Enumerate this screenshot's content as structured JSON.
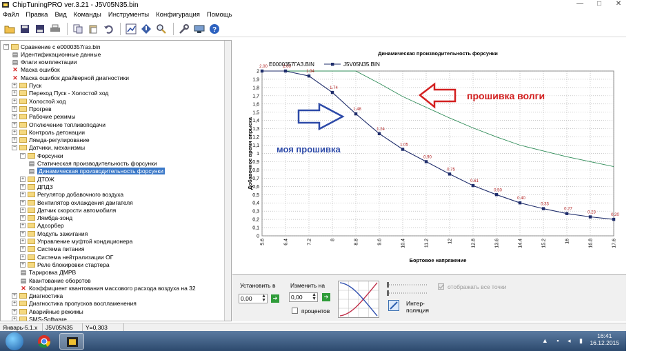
{
  "window": {
    "title": "ChipTuningPRO ver.3.21 - J5V05N35.bin",
    "controls": [
      "—",
      "□",
      "✕"
    ]
  },
  "menu": [
    "Файл",
    "Правка",
    "Вид",
    "Команды",
    "Инструменты",
    "Конфигурация",
    "Помощь"
  ],
  "toolbar_icons": [
    "open-icon",
    "save-icon",
    "save-as-icon",
    "print-icon",
    "copy-icon",
    "paste-icon",
    "undo-icon",
    "chart-icon",
    "diamond-icon",
    "search-icon",
    "tools-icon",
    "device-icon",
    "help-icon"
  ],
  "tree": [
    {
      "level": 0,
      "kind": "folder",
      "exp": "−",
      "label": "Сравнение с e0000357газ.bin"
    },
    {
      "level": 1,
      "kind": "doc",
      "label": "Идентификационные данные"
    },
    {
      "level": 1,
      "kind": "doc",
      "label": "Флаги комплектации"
    },
    {
      "level": 1,
      "kind": "x",
      "label": "Маска ошибок"
    },
    {
      "level": 1,
      "kind": "x",
      "label": "Маска ошибок драйверной диагностики"
    },
    {
      "level": 1,
      "kind": "folder",
      "exp": "+",
      "label": "Пуск"
    },
    {
      "level": 1,
      "kind": "folder",
      "exp": "+",
      "label": "Переход Пуск - Холостой ход"
    },
    {
      "level": 1,
      "kind": "folder",
      "exp": "+",
      "label": "Холостой ход"
    },
    {
      "level": 1,
      "kind": "folder",
      "exp": "+",
      "label": "Прогрев"
    },
    {
      "level": 1,
      "kind": "folder",
      "exp": "+",
      "label": "Рабочие режимы"
    },
    {
      "level": 1,
      "kind": "folder",
      "exp": "+",
      "label": "Отключение топливоподачи"
    },
    {
      "level": 1,
      "kind": "folder",
      "exp": "+",
      "label": "Контроль детонации"
    },
    {
      "level": 1,
      "kind": "folder",
      "exp": "+",
      "label": "Лямда-регулирование"
    },
    {
      "level": 1,
      "kind": "folder",
      "exp": "−",
      "label": "Датчики, механизмы"
    },
    {
      "level": 2,
      "kind": "folder",
      "exp": "−",
      "label": "Форсунки"
    },
    {
      "level": 3,
      "kind": "doc",
      "label": "Статическая производительность форсунки"
    },
    {
      "level": 3,
      "kind": "doc",
      "label": "Динамическая производительность форсунки",
      "selected": true
    },
    {
      "level": 2,
      "kind": "folder",
      "exp": "+",
      "label": "ДТОЖ"
    },
    {
      "level": 2,
      "kind": "folder",
      "exp": "+",
      "label": "ДПДЗ"
    },
    {
      "level": 2,
      "kind": "folder",
      "exp": "+",
      "label": "Регулятор добавочного воздуха"
    },
    {
      "level": 2,
      "kind": "folder",
      "exp": "+",
      "label": "Вентилятор охлаждения двигателя"
    },
    {
      "level": 2,
      "kind": "folder",
      "exp": "+",
      "label": "Датчик скорости автомобиля"
    },
    {
      "level": 2,
      "kind": "folder",
      "exp": "+",
      "label": "Лямбда-зонд"
    },
    {
      "level": 2,
      "kind": "folder",
      "exp": "+",
      "label": "Адсорбер"
    },
    {
      "level": 2,
      "kind": "folder",
      "exp": "+",
      "label": "Модуль зажигания"
    },
    {
      "level": 2,
      "kind": "folder",
      "exp": "+",
      "label": "Управление муфтой кондиционера"
    },
    {
      "level": 2,
      "kind": "folder",
      "exp": "+",
      "label": "Система питания"
    },
    {
      "level": 2,
      "kind": "folder",
      "exp": "+",
      "label": "Система нейтрализации ОГ"
    },
    {
      "level": 2,
      "kind": "folder",
      "exp": "+",
      "label": "Реле блокировки стартера"
    },
    {
      "level": 2,
      "kind": "doc",
      "label": "Тарировка ДМРВ"
    },
    {
      "level": 2,
      "kind": "doc",
      "label": "Квантование оборотов"
    },
    {
      "level": 2,
      "kind": "x",
      "label": "Коэффициент квантования массового расхода воздуха на 32"
    },
    {
      "level": 1,
      "kind": "folder",
      "exp": "+",
      "label": "Диагностика"
    },
    {
      "level": 1,
      "kind": "folder",
      "exp": "+",
      "label": "Диагностика пропусков воспламенения"
    },
    {
      "level": 1,
      "kind": "folder",
      "exp": "+",
      "label": "Аварийные режимы"
    },
    {
      "level": 1,
      "kind": "folder",
      "exp": "+",
      "label": "SMS-Software"
    }
  ],
  "chart_data": {
    "type": "line",
    "title": "Динамическая производительность форсунки",
    "xlabel": "Бортовое напряжение",
    "ylabel": "Добавочное время впрыска",
    "x": [
      5.6,
      6.4,
      7.2,
      8,
      8.8,
      9.6,
      10.4,
      11.2,
      12,
      12.8,
      13.6,
      14.4,
      15.2,
      16,
      16.8,
      17.6
    ],
    "xticks": [
      "5.6",
      "6.4",
      "7.2",
      "8",
      "8.8",
      "9.6",
      "10.4",
      "11.2",
      "12",
      "12.8",
      "13.6",
      "14.4",
      "15.2",
      "16",
      "16.8",
      "17.6"
    ],
    "xlim": [
      5.6,
      17.6
    ],
    "ylim": [
      0,
      2
    ],
    "yticks": [
      "0",
      "0,1",
      "0,2",
      "0,3",
      "0,4",
      "0,5",
      "0,6",
      "0,7",
      "0,8",
      "0,9",
      "1",
      "1,1",
      "1,2",
      "1,3",
      "1,4",
      "1,5",
      "1,6",
      "1,7",
      "1,8",
      "1,9",
      "2"
    ],
    "grid": true,
    "series": [
      {
        "name": "E0000357ГАЗ.BIN",
        "color": "#2e8b57",
        "markers": false,
        "values": [
          2.0,
          2.0,
          2.0,
          2.0,
          2.0,
          1.85,
          1.69,
          1.56,
          1.43,
          1.31,
          1.2,
          1.1,
          1.03,
          0.96,
          0.9,
          0.84
        ]
      },
      {
        "name": "J5V05N35.BIN",
        "color": "#1f2d6b",
        "markers": true,
        "values": [
          2.0,
          2.0,
          1.94,
          1.74,
          1.48,
          1.24,
          1.05,
          0.9,
          0.75,
          0.61,
          0.5,
          0.4,
          0.33,
          0.27,
          0.23,
          0.2
        ],
        "labels": [
          "2.00",
          "2.00",
          "1.94",
          "1.74",
          "1.48",
          "1.24",
          "1.05",
          "0.90",
          "0.75",
          "0.61",
          "0.50",
          "0.40",
          "0.33",
          "0.27",
          "0.23",
          "0.20"
        ]
      }
    ],
    "legend_placement": "top-left",
    "annotations": [
      {
        "text": "прошивка волги",
        "color": "#d32020"
      },
      {
        "text": "моя прошивка",
        "color": "#2d4aa8"
      }
    ]
  },
  "controls": {
    "set_label": "Установить в",
    "set_value": "0,00",
    "change_label": "Изменить на",
    "change_value": "0,00",
    "percent_label": "процентов",
    "interp_label_1": "Интер-",
    "interp_label_2": "поляция",
    "show_all_label": "отображать все точки"
  },
  "status": {
    "cell1": "Январь-5.1.x",
    "cell2": "J5V05N35",
    "cell3": "Y=0,303"
  },
  "tray": {
    "time": "16:41",
    "date": "16.12.2015"
  }
}
